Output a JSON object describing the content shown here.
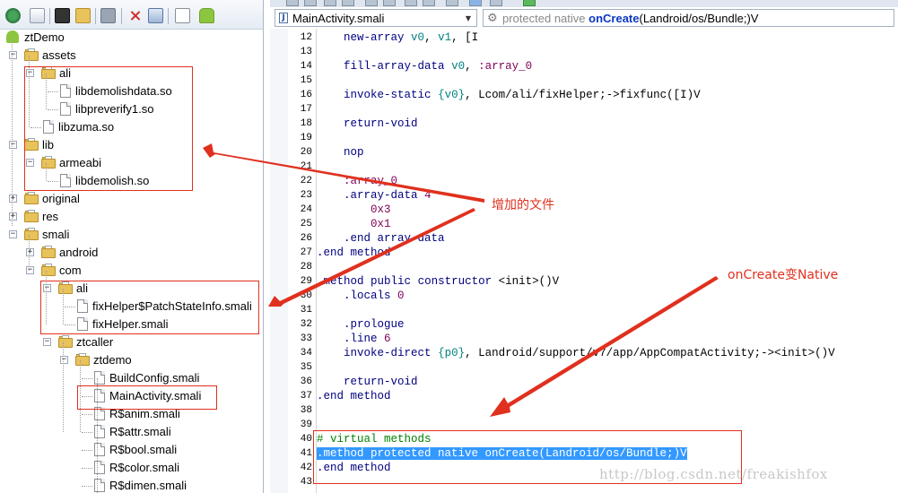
{
  "toolbar": {
    "buttons": [
      "refresh-icon",
      "export-icon",
      "terminal-icon",
      "search-folder-icon",
      "bookmark-icon",
      "delete-icon",
      "rename-icon",
      "text-file-icon",
      "android-icon"
    ]
  },
  "tree": {
    "root": "ztDemo",
    "items": [
      {
        "label": "assets",
        "kind": "folder",
        "depth": 1,
        "expander": "-"
      },
      {
        "label": "ali",
        "kind": "folder",
        "depth": 2,
        "expander": "-"
      },
      {
        "label": "libdemolishdata.so",
        "kind": "file",
        "depth": 3
      },
      {
        "label": "libpreverify1.so",
        "kind": "file",
        "depth": 3
      },
      {
        "label": "libzuma.so",
        "kind": "file",
        "depth": 2
      },
      {
        "label": "lib",
        "kind": "folder",
        "depth": 1,
        "expander": "-"
      },
      {
        "label": "armeabi",
        "kind": "folder",
        "depth": 2,
        "expander": "-"
      },
      {
        "label": "libdemolish.so",
        "kind": "file",
        "depth": 3
      },
      {
        "label": "original",
        "kind": "folder",
        "depth": 1,
        "expander": "+"
      },
      {
        "label": "res",
        "kind": "folder",
        "depth": 1,
        "expander": "+"
      },
      {
        "label": "smali",
        "kind": "folder",
        "depth": 1,
        "expander": "-"
      },
      {
        "label": "android",
        "kind": "folder",
        "depth": 2,
        "expander": "+"
      },
      {
        "label": "com",
        "kind": "folder",
        "depth": 2,
        "expander": "-"
      },
      {
        "label": "ali",
        "kind": "folder",
        "depth": 3,
        "expander": "-"
      },
      {
        "label": "fixHelper$PatchStateInfo.smali",
        "kind": "file",
        "depth": 4
      },
      {
        "label": "fixHelper.smali",
        "kind": "file",
        "depth": 4
      },
      {
        "label": "ztcaller",
        "kind": "folder",
        "depth": 3,
        "expander": "-"
      },
      {
        "label": "ztdemo",
        "kind": "folder",
        "depth": 4,
        "expander": "-"
      },
      {
        "label": "BuildConfig.smali",
        "kind": "file",
        "depth": 5
      },
      {
        "label": "MainActivity.smali",
        "kind": "file",
        "depth": 5
      },
      {
        "label": "R$anim.smali",
        "kind": "file",
        "depth": 5
      },
      {
        "label": "R$attr.smali",
        "kind": "file",
        "depth": 5
      },
      {
        "label": "R$bool.smali",
        "kind": "file",
        "depth": 5
      },
      {
        "label": "R$color.smali",
        "kind": "file",
        "depth": 5
      },
      {
        "label": "R$dimen.smali",
        "kind": "file",
        "depth": 5
      }
    ]
  },
  "editor": {
    "class_selector": "MainActivity.smali",
    "method_selector": {
      "modifiers": "protected native",
      "name": "onCreate",
      "signature": "(Landroid/os/Bundle;)V"
    },
    "lines": [
      {
        "n": "12",
        "text": "    new-array v0, v1, [I"
      },
      {
        "n": "13",
        "text": ""
      },
      {
        "n": "14",
        "text": "    fill-array-data v0, :array_0"
      },
      {
        "n": "15",
        "text": ""
      },
      {
        "n": "16",
        "text": "    invoke-static {v0}, Lcom/ali/fixHelper;->fixfunc([I)V"
      },
      {
        "n": "17",
        "text": ""
      },
      {
        "n": "18",
        "text": "    return-void"
      },
      {
        "n": "19",
        "text": ""
      },
      {
        "n": "20",
        "text": "    nop"
      },
      {
        "n": "21",
        "text": ""
      },
      {
        "n": "22",
        "text": "    :array_0"
      },
      {
        "n": "23",
        "text": "    .array-data 4"
      },
      {
        "n": "24",
        "text": "        0x3"
      },
      {
        "n": "25",
        "text": "        0x1"
      },
      {
        "n": "26",
        "text": "    .end array-data"
      },
      {
        "n": "27",
        "text": ".end method"
      },
      {
        "n": "28",
        "text": ""
      },
      {
        "n": "29",
        "text": ".method public constructor <init>()V"
      },
      {
        "n": "30",
        "text": "    .locals 0"
      },
      {
        "n": "31",
        "text": ""
      },
      {
        "n": "32",
        "text": "    .prologue"
      },
      {
        "n": "33",
        "text": "    .line 6"
      },
      {
        "n": "34",
        "text": "    invoke-direct {p0}, Landroid/support/v7/app/AppCompatActivity;-><init>()V"
      },
      {
        "n": "35",
        "text": ""
      },
      {
        "n": "36",
        "text": "    return-void"
      },
      {
        "n": "37",
        "text": ".end method"
      },
      {
        "n": "38",
        "text": ""
      },
      {
        "n": "39",
        "text": ""
      },
      {
        "n": "40",
        "text": "# virtual methods"
      },
      {
        "n": "41",
        "text": ".method protected native onCreate(Landroid/os/Bundle;)V"
      },
      {
        "n": "42",
        "text": ".end method"
      },
      {
        "n": "43",
        "text": ""
      }
    ]
  },
  "annotations": {
    "added_files": "增加的文件",
    "oncreate_native": "onCreate变Native",
    "color": "#e0301e"
  },
  "watermark": "http://blog.csdn.net/freakishfox"
}
